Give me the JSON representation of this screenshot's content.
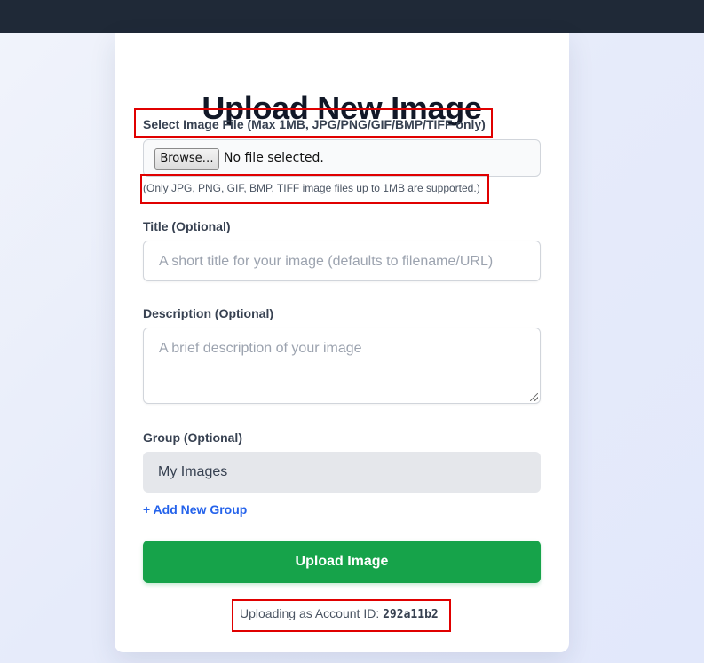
{
  "form": {
    "title": "Upload New Image",
    "file": {
      "label": "Select Image File (Max 1MB, JPG/PNG/GIF/BMP/TIFF only)",
      "browse_label": "Browse…",
      "status": "No file selected.",
      "hint": "(Only JPG, PNG, GIF, BMP, TIFF image files up to 1MB are supported.)"
    },
    "title_field": {
      "label": "Title (Optional)",
      "placeholder": "A short title for your image (defaults to filename/URL)"
    },
    "description_field": {
      "label": "Description (Optional)",
      "placeholder": "A brief description of your image"
    },
    "group_field": {
      "label": "Group (Optional)",
      "selected": "My Images"
    },
    "add_group_label": "+ Add New Group",
    "submit_label": "Upload Image",
    "account": {
      "prefix": "Uploading as Account ID:",
      "id": "292a11b2"
    }
  },
  "colors": {
    "topbar": "#1f2937",
    "primary_button": "#16a34a",
    "link": "#2563eb",
    "highlight_box": "#e00000"
  }
}
